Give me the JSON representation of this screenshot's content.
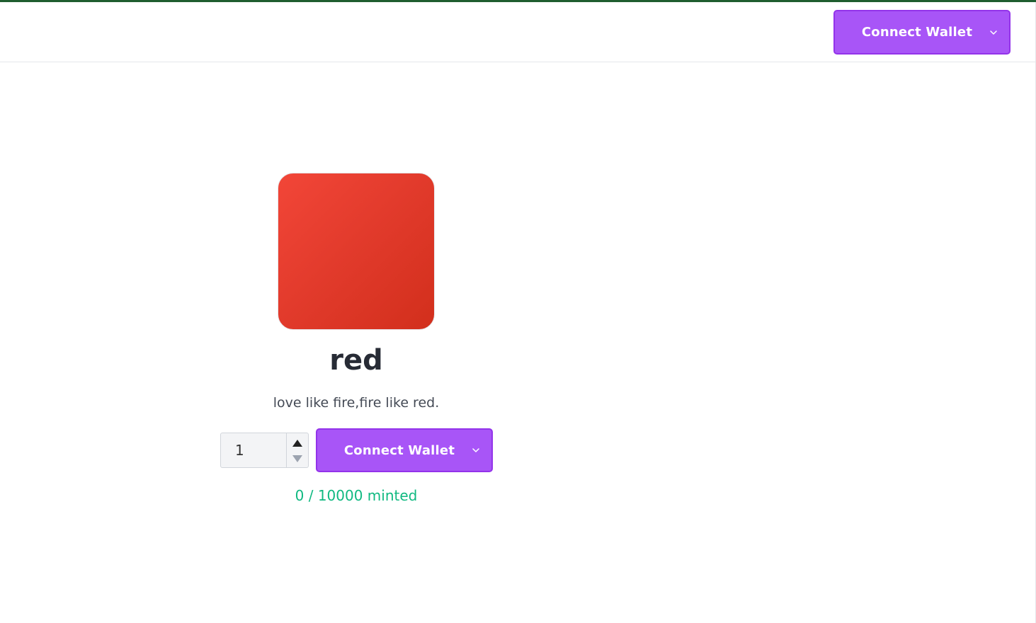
{
  "header": {
    "connect_wallet_label": "Connect Wallet"
  },
  "collection": {
    "name": "red",
    "description": "love like fire,fire like red.",
    "swatch_color": "#e13a2b",
    "quantity": "1",
    "connect_wallet_label": "Connect Wallet",
    "minted_status": "0 / 10000 minted"
  },
  "colors": {
    "accent": "#a855f7",
    "minted_text": "#10b981",
    "top_bar": "#1f5d2f"
  },
  "icons": {
    "dropdown": "chevron-down-icon",
    "spin_up": "triangle-up-icon",
    "spin_down": "triangle-down-icon"
  }
}
